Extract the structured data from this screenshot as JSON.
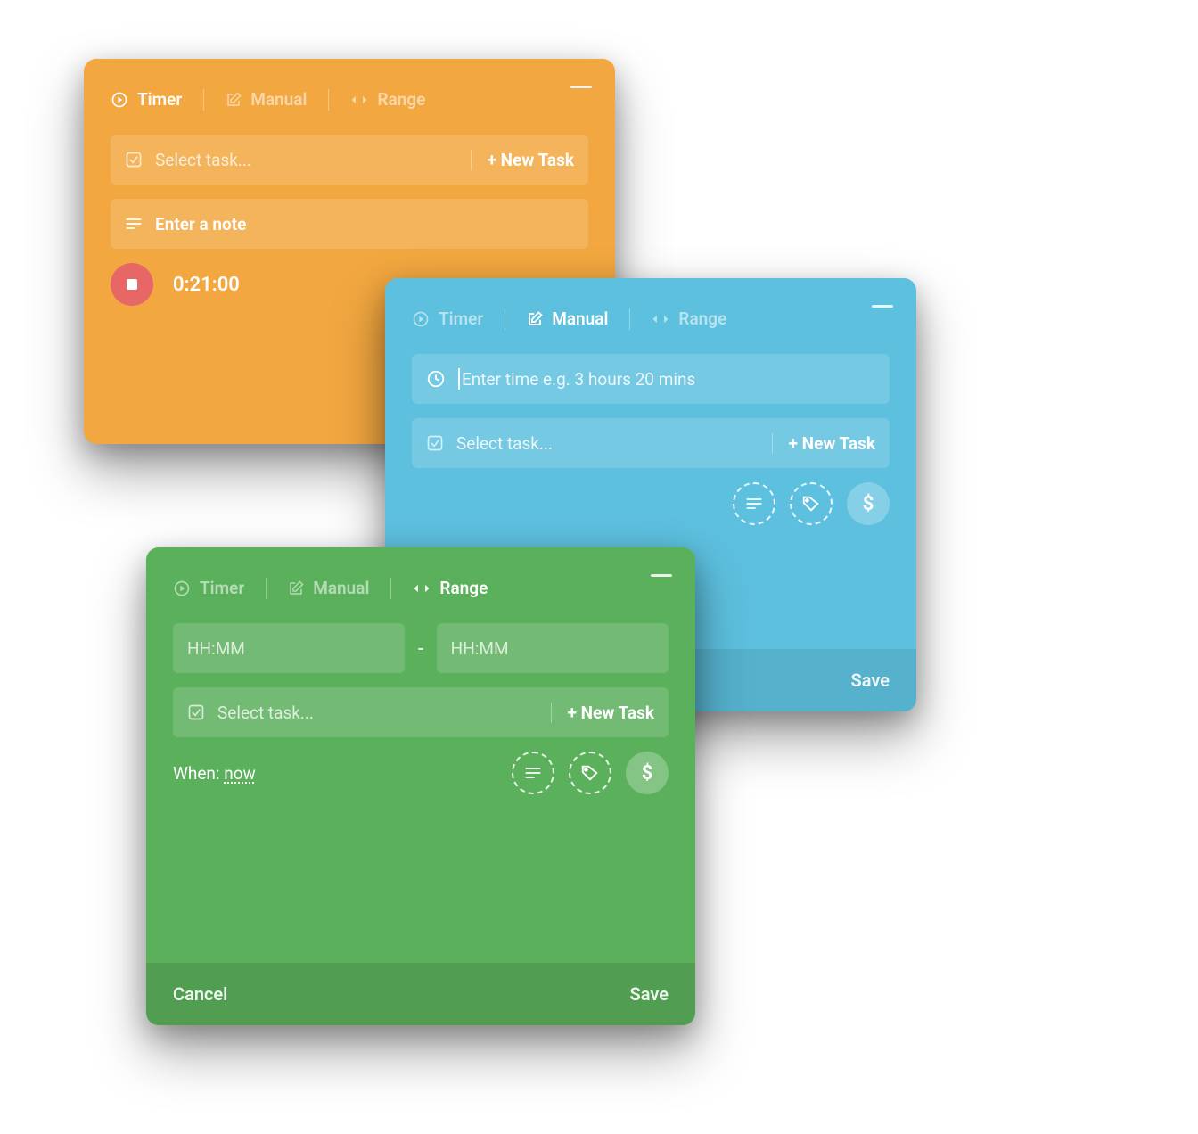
{
  "tabs": {
    "timer": "Timer",
    "manual": "Manual",
    "range": "Range"
  },
  "common": {
    "select_task": "Select task...",
    "new_task": "+ New Task",
    "save": "Save",
    "cancel": "Cancel"
  },
  "orange": {
    "active_tab": "timer",
    "note_placeholder": "Enter a note",
    "elapsed": "0:21:00"
  },
  "blue": {
    "active_tab": "manual",
    "time_placeholder": "Enter time e.g. 3 hours 20 mins"
  },
  "green": {
    "active_tab": "range",
    "hhmm_placeholder": "HH:MM",
    "range_separator": "-",
    "when_label": "When:",
    "when_value": "now"
  },
  "icons": {
    "note": "note-icon",
    "tag": "tag-icon",
    "billable": "dollar-icon"
  }
}
